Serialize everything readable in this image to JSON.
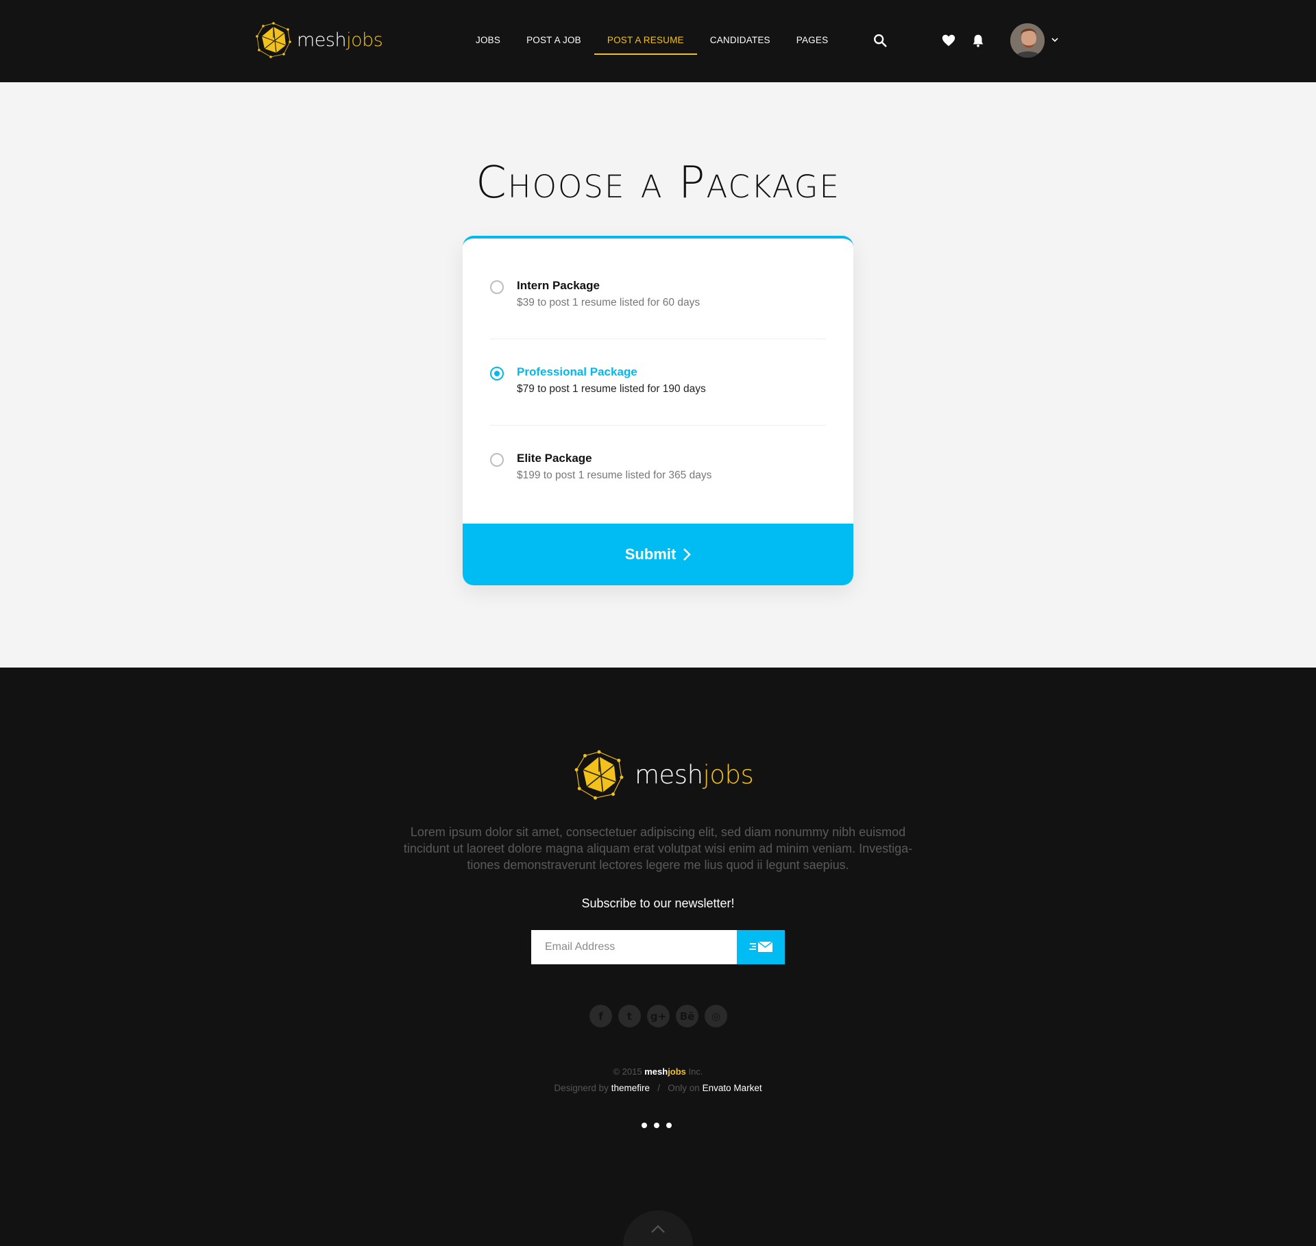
{
  "brand": {
    "part1": "mesh",
    "part2": "jobs"
  },
  "nav": {
    "items": [
      {
        "label": "JOBS"
      },
      {
        "label": "POST A JOB"
      },
      {
        "label": "POST A RESUME",
        "active": true
      },
      {
        "label": "CANDIDATES"
      },
      {
        "label": "PAGES"
      }
    ]
  },
  "header_icons": [
    "search-icon",
    "heart-icon",
    "bell-icon",
    "avatar",
    "chevron-down-icon"
  ],
  "page": {
    "title": "Choose a Package"
  },
  "packages": [
    {
      "name": "Intern Package",
      "description": "$39 to post 1 resume listed for 60 days",
      "selected": false
    },
    {
      "name": "Professional Package",
      "description": "$79 to post 1 resume listed for 190 days",
      "selected": true
    },
    {
      "name": "Elite Package",
      "description": "$199 to post 1 resume listed for 365 days",
      "selected": false
    }
  ],
  "submit": {
    "label": "Submit"
  },
  "footer": {
    "about": "Lorem ipsum dolor sit amet, consectetuer adipiscing elit, sed diam nonummy nibh euismod tincidunt ut laoreet dolore magna aliquam erat volutpat wisi enim ad minim veniam. Investiga-tiones demonstraverunt lectores legere me lius quod ii legunt saepius.",
    "newsletter_title": "Subscribe to our newsletter!",
    "email_placeholder": "Email Address",
    "socials": [
      {
        "icon": "facebook-icon",
        "glyph": "f"
      },
      {
        "icon": "twitter-icon",
        "glyph": "t"
      },
      {
        "icon": "google-plus-icon",
        "glyph": "g+"
      },
      {
        "icon": "behance-icon",
        "glyph": "Bē"
      },
      {
        "icon": "dribbble-icon",
        "glyph": "◎"
      }
    ],
    "copyright_prefix": "© 2015",
    "copyright_suffix": "Inc.",
    "designed_by_label": "Designerd by",
    "designer": "themefire",
    "separator": "/",
    "only_on_label": "Only on",
    "marketplace": "Envato Market"
  },
  "colors": {
    "accent": "#00b9ef",
    "brand_yellow": "#f3c21a",
    "dark": "#131313",
    "background": "#f4f4f4"
  }
}
